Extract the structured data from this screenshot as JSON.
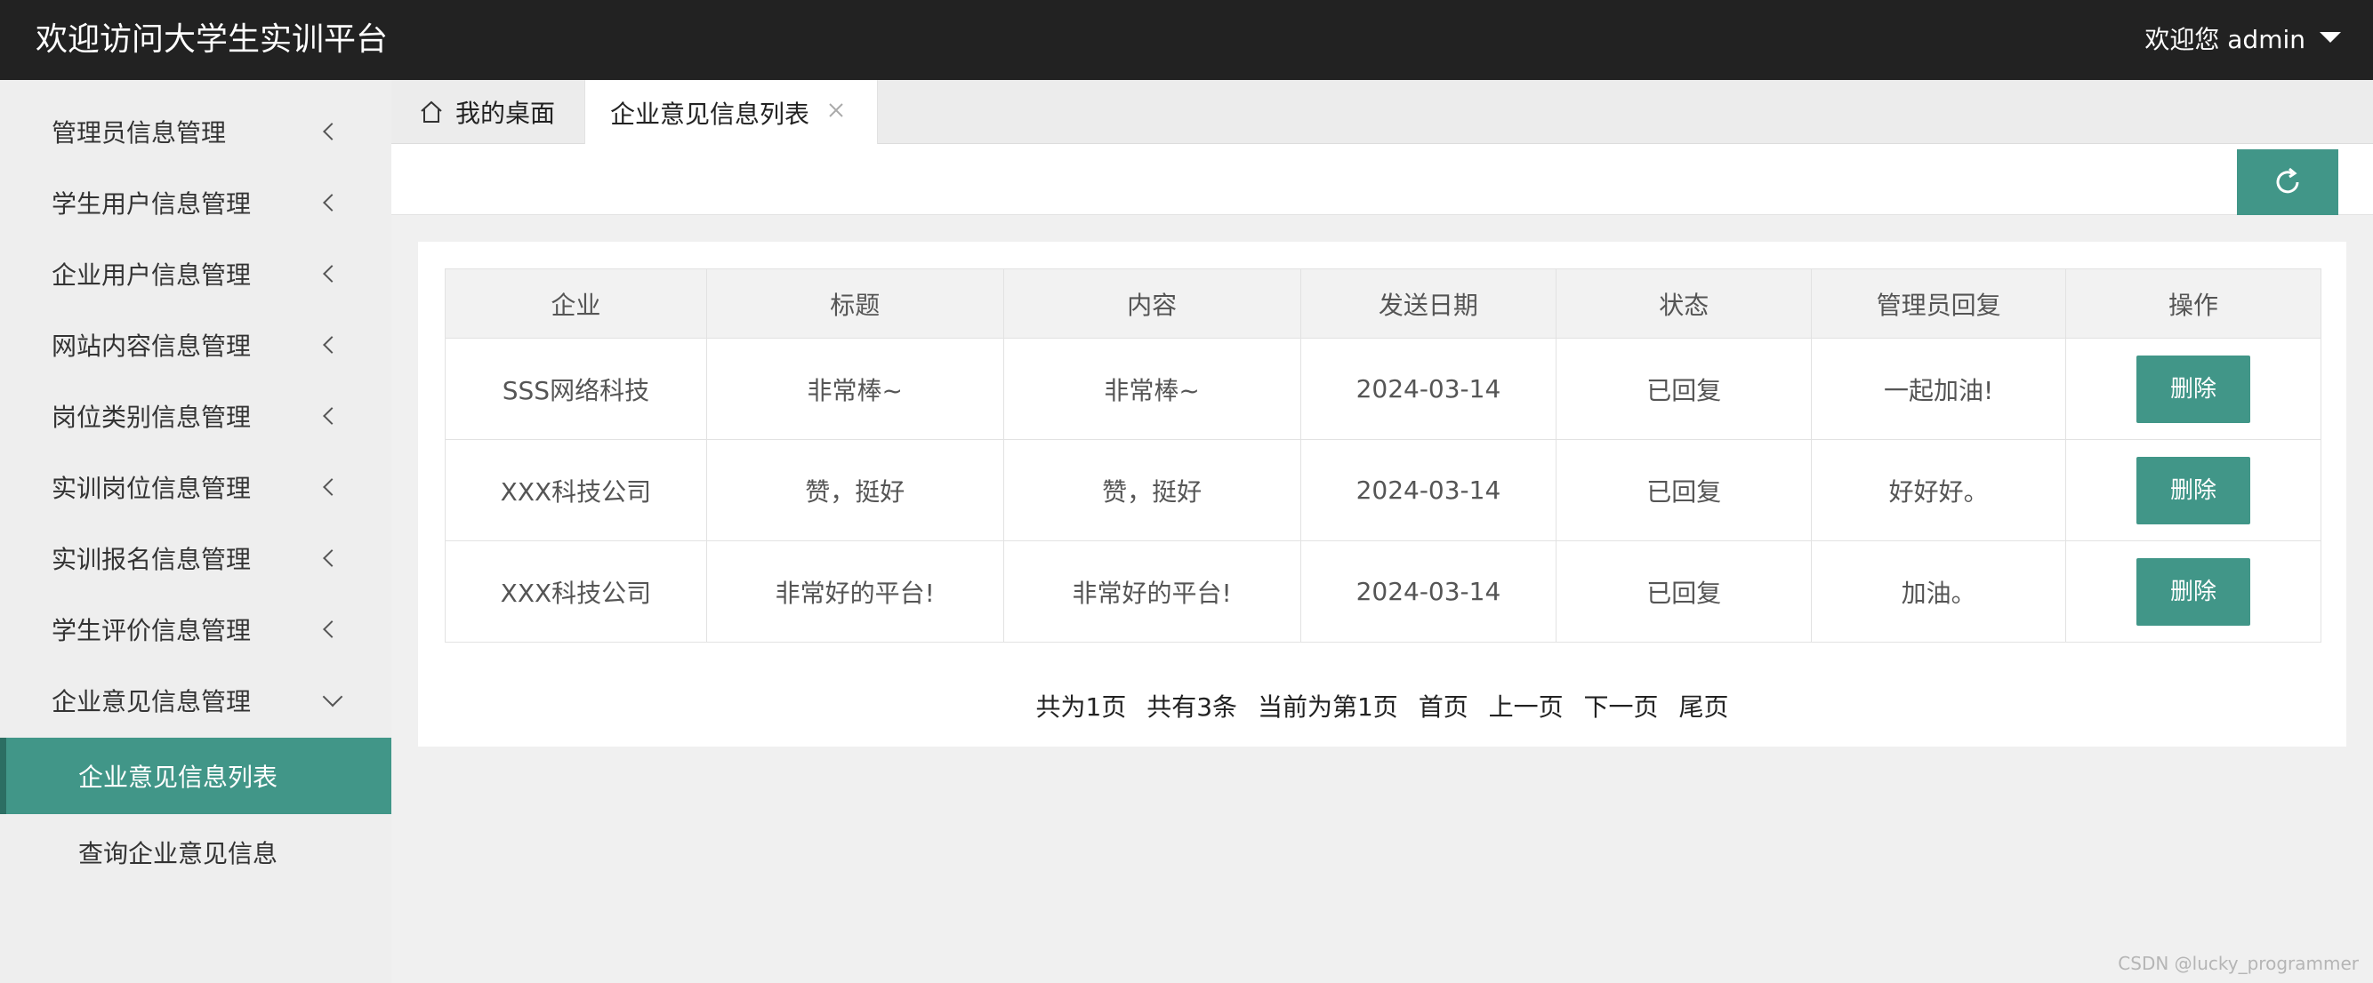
{
  "header": {
    "title": "欢迎访问大学生实训平台",
    "user_greeting": "欢迎您 admin"
  },
  "sidebar": {
    "items": [
      {
        "label": "管理员信息管理"
      },
      {
        "label": "学生用户信息管理"
      },
      {
        "label": "企业用户信息管理"
      },
      {
        "label": "网站内容信息管理"
      },
      {
        "label": "岗位类别信息管理"
      },
      {
        "label": "实训岗位信息管理"
      },
      {
        "label": "实训报名信息管理"
      },
      {
        "label": "学生评价信息管理"
      },
      {
        "label": "企业意见信息管理"
      }
    ],
    "sub_items": [
      {
        "label": "企业意见信息列表"
      },
      {
        "label": "查询企业意见信息"
      }
    ]
  },
  "tabs": {
    "home": "我的桌面",
    "active": "企业意见信息列表"
  },
  "table": {
    "headers": [
      "企业",
      "标题",
      "内容",
      "发送日期",
      "状态",
      "管理员回复",
      "操作"
    ],
    "rows": [
      {
        "company": "SSS网络科技",
        "title": "非常棒~",
        "content": "非常棒~",
        "date": "2024-03-14",
        "status": "已回复",
        "reply": "一起加油!",
        "action": "删除"
      },
      {
        "company": "XXX科技公司",
        "title": "赞，挺好",
        "content": "赞，挺好",
        "date": "2024-03-14",
        "status": "已回复",
        "reply": "好好好。",
        "action": "删除"
      },
      {
        "company": "XXX科技公司",
        "title": "非常好的平台!",
        "content": "非常好的平台!",
        "date": "2024-03-14",
        "status": "已回复",
        "reply": "加油。",
        "action": "删除"
      }
    ]
  },
  "pagination": {
    "total_pages": "共为1页",
    "total_items": "共有3条",
    "current": "当前为第1页",
    "first": "首页",
    "prev": "上一页",
    "next": "下一页",
    "last": "尾页"
  },
  "watermark": "CSDN @lucky_programmer",
  "colors": {
    "accent": "#419688",
    "header_bg": "#222222"
  }
}
